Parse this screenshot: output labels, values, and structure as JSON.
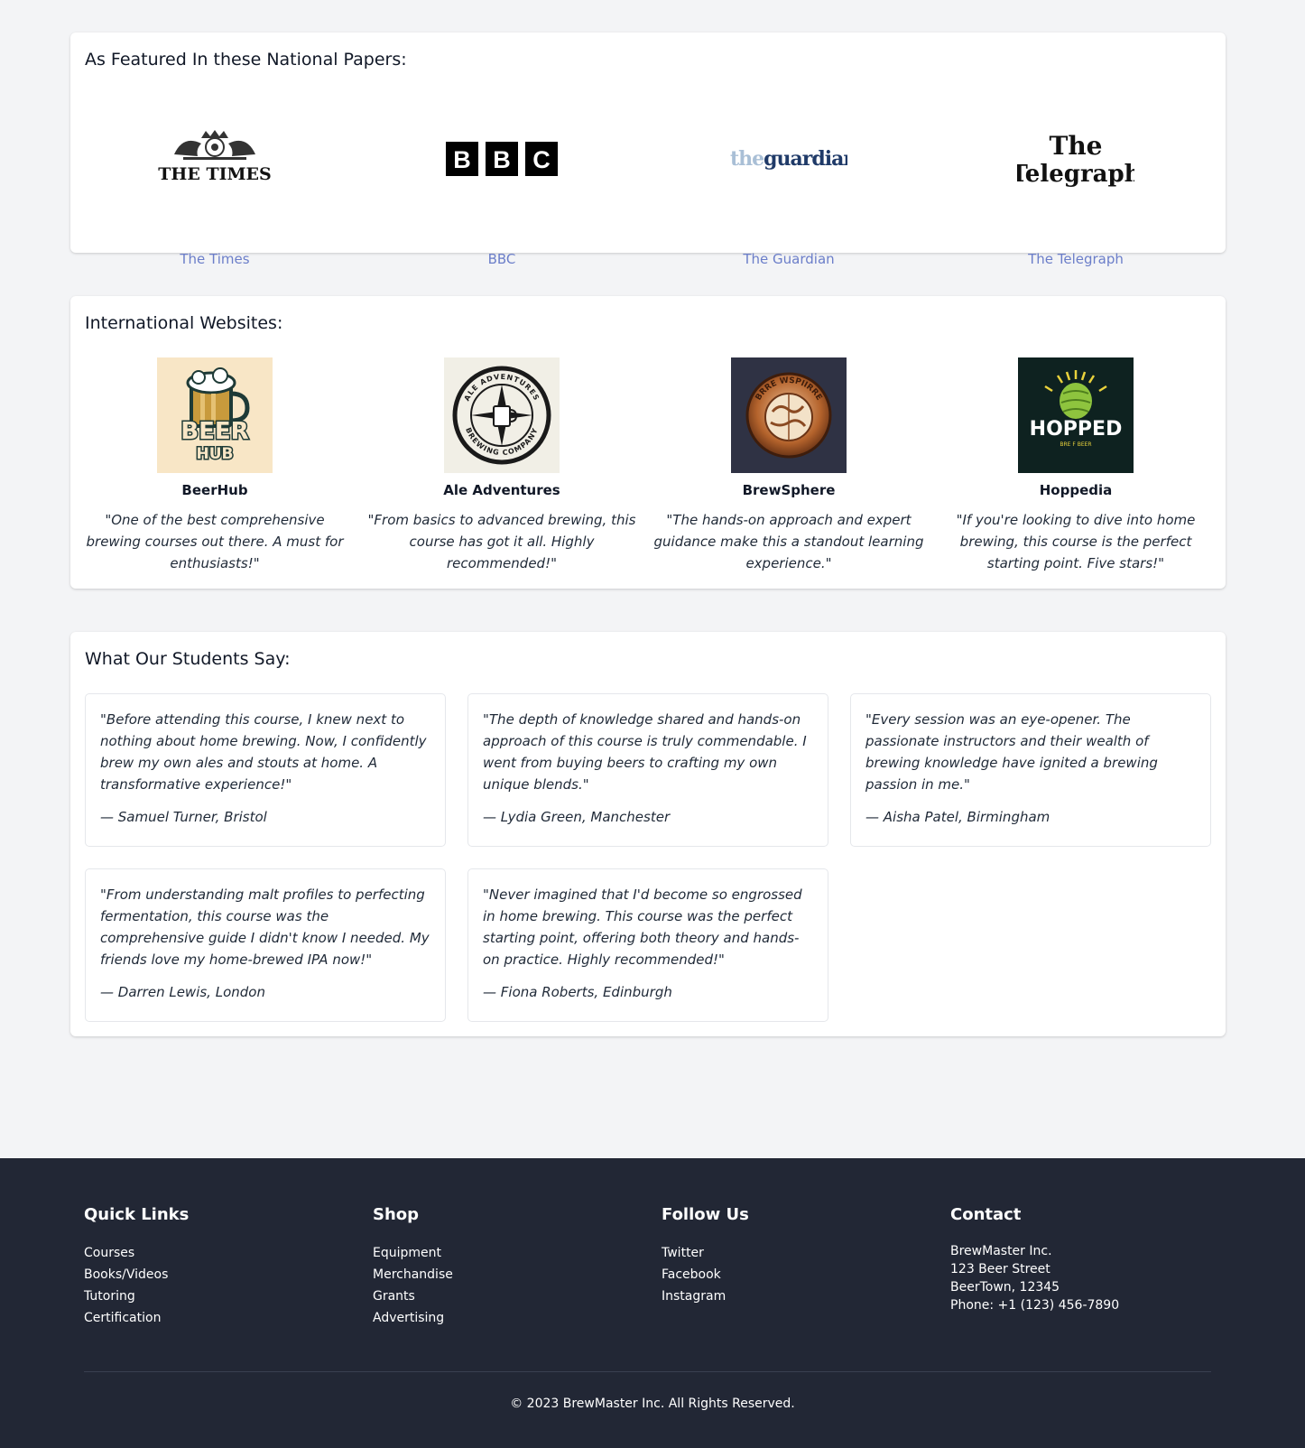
{
  "papers_section": {
    "title": "As Featured In these National Papers:",
    "items": [
      {
        "name": "The Times",
        "logo_text": "THE TIMES"
      },
      {
        "name": "BBC",
        "logo_letters": [
          "B",
          "B",
          "C"
        ]
      },
      {
        "name": "The Guardian",
        "logo_prefix": "the",
        "logo_main": "guardian"
      },
      {
        "name": "The Telegraph",
        "logo_line1": "The",
        "logo_line2": "Telegraph"
      }
    ]
  },
  "websites_section": {
    "title": "International Websites:",
    "items": [
      {
        "name": "BeerHub",
        "quote": "\"One of the best comprehensive brewing courses out there. A must for enthusiasts!\"",
        "logo_line1": "BEER",
        "logo_line2": "HUB"
      },
      {
        "name": "Ale Adventures",
        "quote": "\"From basics to advanced brewing, this course has got it all. Highly recommended!\"",
        "logo_ring_top": "ALE ADVENTURES",
        "logo_ring_bottom": "BREWING COMPANY"
      },
      {
        "name": "BrewSphere",
        "quote": "\"The hands-on approach and expert guidance make this a standout learning experience.\"",
        "logo_ring_top": "BRRE WSPIIRRE"
      },
      {
        "name": "Hoppedia",
        "quote": "\"If you're looking to dive into home brewing, this course is the perfect starting point. Five stars!\"",
        "logo_text": "HOPPED",
        "logo_sub": "BRE F BEER"
      }
    ]
  },
  "students_section": {
    "title": "What Our Students Say:",
    "testimonials": [
      {
        "quote": "\"Before attending this course, I knew next to nothing about home brewing. Now, I confidently brew my own ales and stouts at home. A transformative experience!\"",
        "author": "— Samuel Turner, Bristol"
      },
      {
        "quote": "\"The depth of knowledge shared and hands-on approach of this course is truly commendable. I went from buying beers to crafting my own unique blends.\"",
        "author": "— Lydia Green, Manchester"
      },
      {
        "quote": "\"Every session was an eye-opener. The passionate instructors and their wealth of brewing knowledge have ignited a brewing passion in me.\"",
        "author": "— Aisha Patel, Birmingham"
      },
      {
        "quote": "\"From understanding malt profiles to perfecting fermentation, this course was the comprehensive guide I didn't know I needed. My friends love my home-brewed IPA now!\"",
        "author": "— Darren Lewis, London"
      },
      {
        "quote": "\"Never imagined that I'd become so engrossed in home brewing. This course was the perfect starting point, offering both theory and hands-on practice. Highly recommended!\"",
        "author": "— Fiona Roberts, Edinburgh"
      }
    ]
  },
  "footer": {
    "quick_links": {
      "title": "Quick Links",
      "items": [
        "Courses",
        "Books/Videos",
        "Tutoring",
        "Certification"
      ]
    },
    "shop": {
      "title": "Shop",
      "items": [
        "Equipment",
        "Merchandise",
        "Grants",
        "Advertising"
      ]
    },
    "follow": {
      "title": "Follow Us",
      "items": [
        "Twitter",
        "Facebook",
        "Instagram"
      ]
    },
    "contact": {
      "title": "Contact",
      "lines": [
        "BrewMaster Inc.",
        "123 Beer Street",
        "BeerTown, 12345",
        "Phone: +1 (123) 456-7890"
      ]
    },
    "copyright": "© 2023 BrewMaster Inc. All Rights Reserved."
  },
  "colors": {
    "page_bg": "#f3f4f6",
    "card_bg": "#ffffff",
    "paper_name": "#6b7ec9",
    "footer_bg": "#222735"
  }
}
